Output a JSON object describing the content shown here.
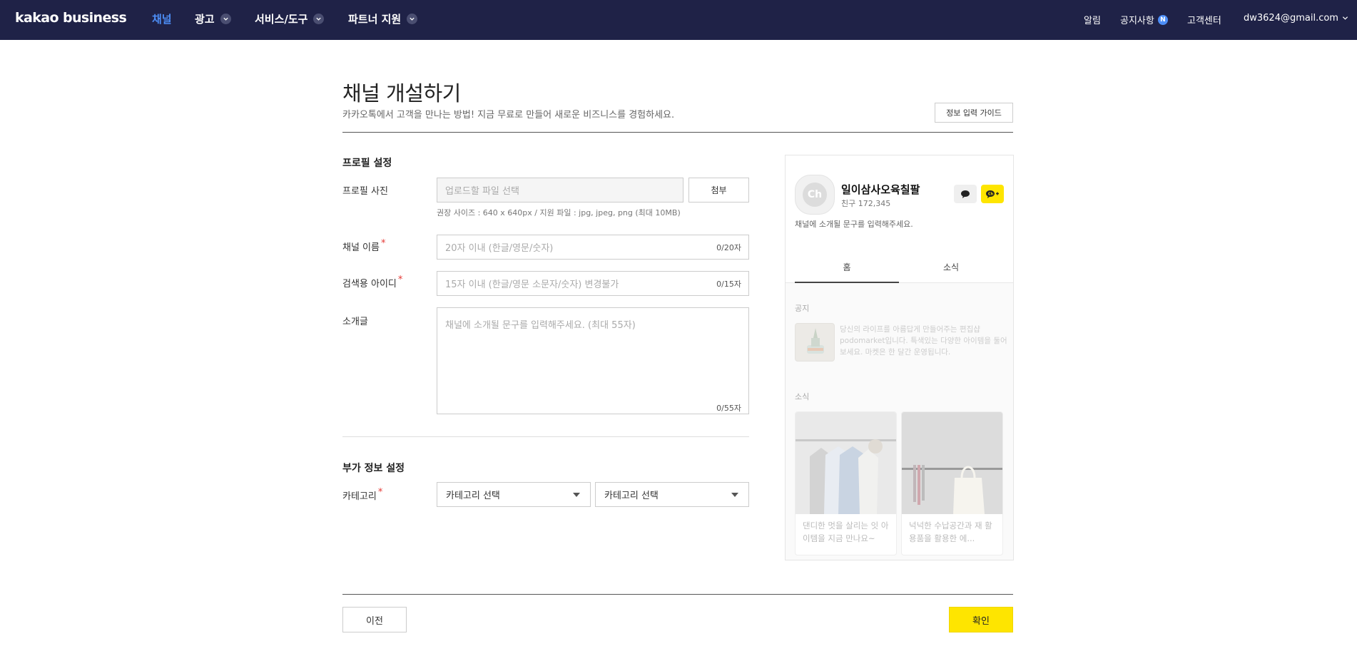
{
  "topnav": {
    "logo": "kakao business",
    "items": [
      {
        "label": "채널",
        "active": true
      },
      {
        "label": "광고"
      },
      {
        "label": "서비스/도구"
      },
      {
        "label": "파트너 지원"
      }
    ],
    "alerts": "알림",
    "notice": "공지사항",
    "notice_badge": "N",
    "support": "고객센터",
    "account": "dw3624@gmail.com"
  },
  "header": {
    "title": "채널 개설하기",
    "subtitle": "카카오톡에서 고객을 만나는 방법! 지금 무료로 만들어 새로운 비즈니스를 경험하세요.",
    "guide_button": "정보 입력 가이드"
  },
  "profile": {
    "section_title": "프로필 설정",
    "photo_label": "프로필 사진",
    "photo_placeholder": "업로드할 파일 선택",
    "attach_button": "첨부",
    "photo_hint": "권장 사이즈 : 640 x 640px / 지원 파일 : jpg, jpeg, png (최대 10MB)",
    "name_label": "채널 이름",
    "name_placeholder": "20자 이내 (한글/영문/숫자)",
    "name_count": "0/20자",
    "id_label": "검색용 아이디",
    "id_placeholder": "15자 이내 (한글/영문 소문자/숫자) 변경불가",
    "id_count": "0/15자",
    "intro_label": "소개글",
    "intro_placeholder": "채널에 소개될 문구를 입력해주세요. (최대 55자)",
    "intro_count": "0/55자",
    "required_mark": "*"
  },
  "extra": {
    "section_title": "부가 정보 설정",
    "category_label": "카테고리",
    "category_select_1": "카테고리 선택",
    "category_select_2": "카테고리 선택"
  },
  "preview": {
    "avatar_text": "Ch",
    "channel_name": "일이삼사오육칠팔",
    "friends": "친구 172,345",
    "description": "채널에 소개될 문구를 입력해주세요.",
    "tab_home": "홈",
    "tab_news": "소식",
    "notice_heading": "공지",
    "notice_text": "당신의 라이프를 아름답게 만들어주는 편집샵 podomarket입니다. 특색있는 다양한 아이템을 둘어보세요. 마켓은 한 달간 운영됩니다.",
    "news_heading": "소식",
    "card_1": "댄디한 멋을 살리는 잇 아이템을 지금 만나요~",
    "card_2": "넉넉한 수납공간과 재 활용품을 활용한 에..."
  },
  "footer": {
    "prev_button": "이전",
    "ok_button": "확인"
  },
  "colors": {
    "nav_bg": "#1f2247",
    "nav_active": "#4d8ef7",
    "primary_yellow": "#fee500",
    "required_red": "#e53935"
  },
  "icons": [
    "chevron-down-icon",
    "chat-bubble-icon",
    "channel-add-icon",
    "hanger-icon"
  ]
}
